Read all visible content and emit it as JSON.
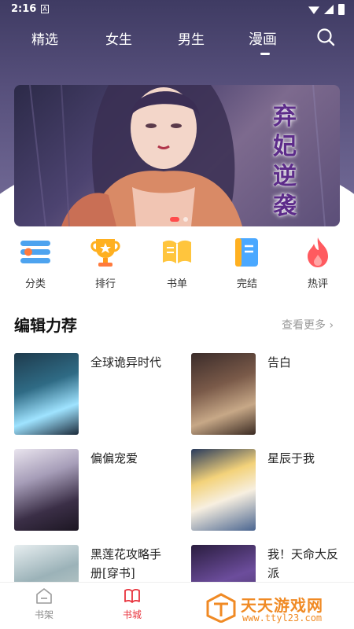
{
  "status_bar": {
    "time": "2:16",
    "app_icon": "A"
  },
  "tabs": [
    {
      "label": "精选"
    },
    {
      "label": "女生"
    },
    {
      "label": "男生"
    },
    {
      "label": "漫画",
      "active": true
    }
  ],
  "banner": {
    "title": "弃妃逆袭",
    "slides": 2,
    "active_slide": 1
  },
  "quick_links": [
    {
      "label": "分类",
      "icon": "category-icon"
    },
    {
      "label": "排行",
      "icon": "trophy-icon"
    },
    {
      "label": "书单",
      "icon": "book-list-icon"
    },
    {
      "label": "完结",
      "icon": "finished-icon"
    },
    {
      "label": "热评",
      "icon": "hot-comment-icon"
    }
  ],
  "section": {
    "title": "编辑力荐",
    "more": "查看更多 ›"
  },
  "books": [
    {
      "title": "全球诡异时代"
    },
    {
      "title": "告白"
    },
    {
      "title": "偏偏宠爱"
    },
    {
      "title": "星辰于我"
    },
    {
      "title": "黑莲花攻略手册[穿书]"
    },
    {
      "title": "我！天命大反派"
    }
  ],
  "bottom_nav": [
    {
      "label": "书架",
      "icon": "bookshelf-icon"
    },
    {
      "label": "书城",
      "icon": "bookstore-icon",
      "active": true
    }
  ],
  "watermark": {
    "name": "天天游戏网",
    "url": "www.ttyl23.com"
  },
  "colors": {
    "accent": "#e8323c",
    "header": "#4f486f"
  }
}
